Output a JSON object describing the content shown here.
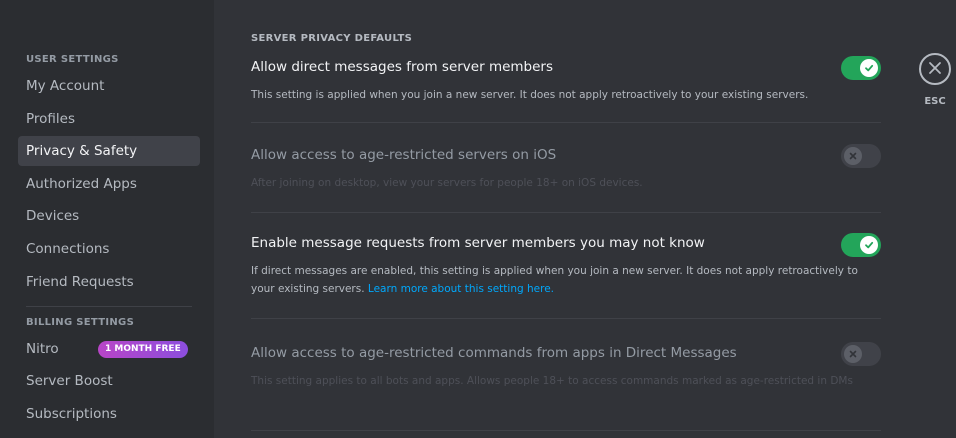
{
  "sidebar": {
    "user_settings_header": "USER SETTINGS",
    "user_items": [
      {
        "label": "My Account"
      },
      {
        "label": "Profiles"
      },
      {
        "label": "Privacy & Safety"
      },
      {
        "label": "Authorized Apps"
      },
      {
        "label": "Devices"
      },
      {
        "label": "Connections"
      },
      {
        "label": "Friend Requests"
      }
    ],
    "billing_settings_header": "BILLING SETTINGS",
    "billing_items": [
      {
        "label": "Nitro",
        "badge": "1 MONTH FREE"
      },
      {
        "label": "Server Boost"
      },
      {
        "label": "Subscriptions"
      }
    ],
    "active_item": "Privacy & Safety"
  },
  "main": {
    "section_header": "SERVER PRIVACY DEFAULTS",
    "settings": [
      {
        "title": "Allow direct messages from server members",
        "description": "This setting is applied when you join a new server. It does not apply retroactively to your existing servers.",
        "enabled": true,
        "disabled": false
      },
      {
        "title": "Allow access to age-restricted servers on iOS",
        "description": "After joining on desktop, view your servers for people 18+ on iOS devices.",
        "enabled": false,
        "disabled": true
      },
      {
        "title": "Enable message requests from server members you may not know",
        "description": "If direct messages are enabled, this setting is applied when you join a new server. It does not apply retroactively to your existing servers.",
        "link": "Learn more about this setting here.",
        "enabled": true,
        "disabled": false
      },
      {
        "title": "Allow access to age-restricted commands from apps in Direct Messages",
        "description": "This setting applies to all bots and apps. Allows people 18+ to access commands marked as age-restricted in DMs",
        "enabled": false,
        "disabled": true
      }
    ]
  },
  "close": {
    "label": "ESC"
  },
  "colors": {
    "toggle_on": "#23a55a",
    "link": "#00a8fc",
    "badge_gradient_start": "#b845c7",
    "badge_gradient_end": "#8c4ede"
  }
}
